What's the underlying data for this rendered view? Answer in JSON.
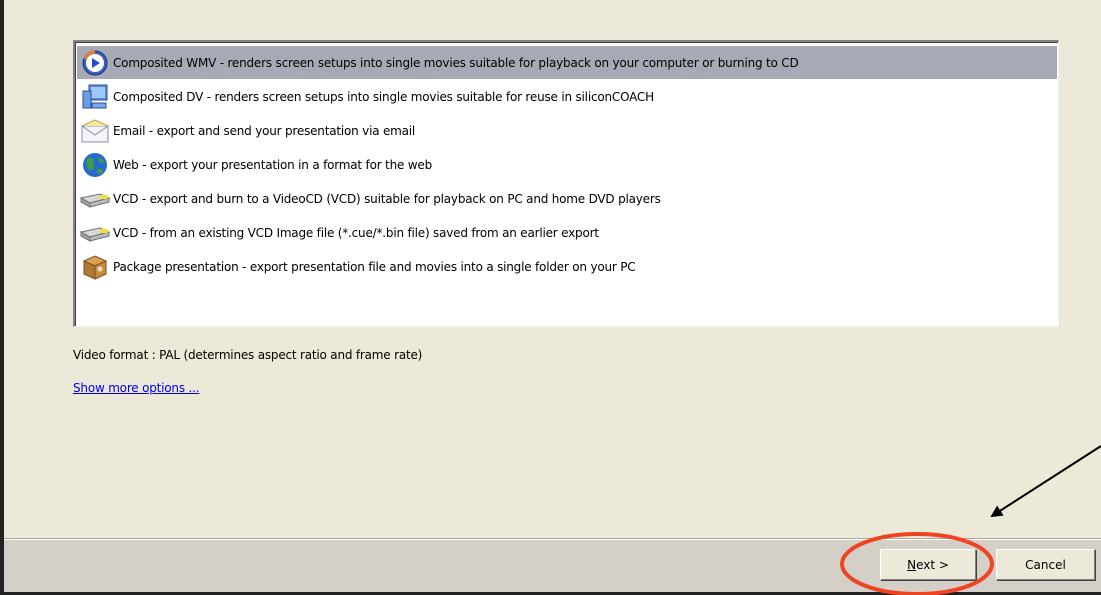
{
  "export_options": [
    {
      "icon": "media-player-icon",
      "label": "Composited WMV -  renders screen setups into single movies suitable for playback on your computer or burning to CD",
      "selected": true
    },
    {
      "icon": "computer-icon",
      "label": "Composited DV -  renders screen setups into single movies suitable for reuse in siliconCOACH",
      "selected": false
    },
    {
      "icon": "envelope-icon",
      "label": "Email - export and send your presentation via email",
      "selected": false
    },
    {
      "icon": "globe-icon",
      "label": "Web - export your presentation in a format for the web",
      "selected": false
    },
    {
      "icon": "cd-drive-icon",
      "label": "VCD - export and burn to a VideoCD (VCD) suitable for playback on PC and home DVD players",
      "selected": false
    },
    {
      "icon": "cd-drive-icon",
      "label": "VCD - from an existing VCD Image file (*.cue/*.bin file) saved from an earlier export",
      "selected": false
    },
    {
      "icon": "package-icon",
      "label": "Package presentation - export presentation file and movies into a single folder on your PC",
      "selected": false
    }
  ],
  "video_format": "Video format : PAL (determines aspect ratio and frame rate)",
  "more_options_link": "Show more options ...",
  "buttons": {
    "next": "Next >",
    "cancel": "Cancel"
  },
  "colors": {
    "dialog_bg": "#ece9d8",
    "selection": "#a6aab4",
    "link": "#0000ee",
    "annotation_circle": "#ee4422"
  }
}
